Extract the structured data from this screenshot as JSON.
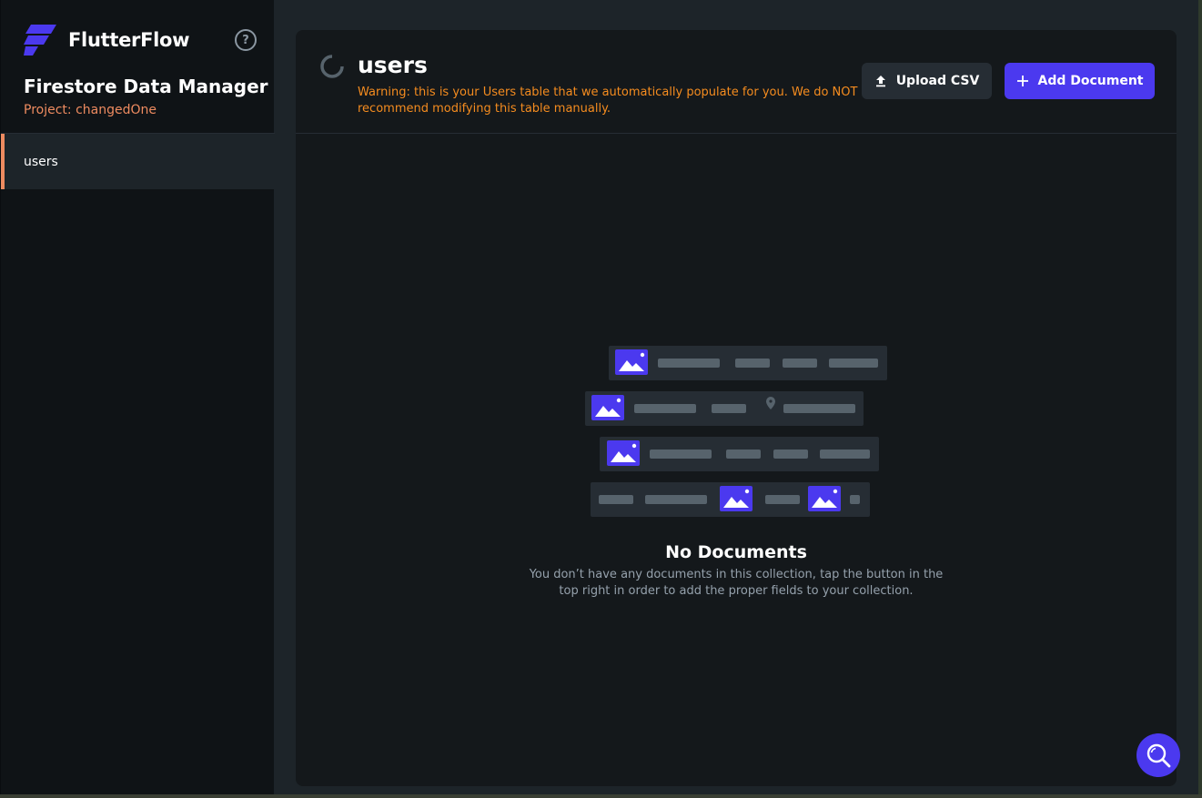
{
  "brand": {
    "name": "FlutterFlow",
    "logo_icon": "flutterflow-logo-icon",
    "help_icon": "help-circle-icon",
    "help_glyph": "?"
  },
  "sidebar": {
    "title": "Firestore Data Manager",
    "project": "Project: changedOne",
    "collections": [
      {
        "label": "users",
        "selected": true
      }
    ]
  },
  "panel": {
    "title": "users",
    "warning": "Warning: this is your Users table that we automatically populate for you. We do NOT recommend modifying this table manually.",
    "upload_label": "Upload CSV",
    "add_label": "Add Document",
    "empty_title": "No Documents",
    "empty_desc": "You don’t have any documents in this collection, tap the button in the top right in order to add the proper fields to your collection."
  },
  "fab": {
    "icon": "search-icon"
  },
  "colors": {
    "accent": "#4b39ef",
    "warning": "#f58c1f",
    "project": "#ee8b60",
    "background": "#1d2429",
    "panel": "#14181b"
  }
}
